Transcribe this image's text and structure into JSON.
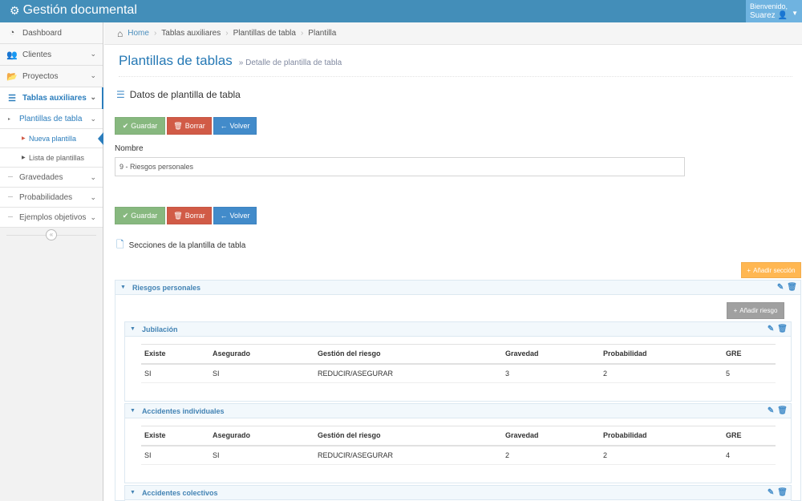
{
  "navbar": {
    "brand": "Gestión documental",
    "welcome": "Bienvenido,",
    "user": "Suarez"
  },
  "sidebar": {
    "items": [
      {
        "label": "Dashboard",
        "icon": "tachometer-icon"
      },
      {
        "label": "Clientes",
        "icon": "users-icon"
      },
      {
        "label": "Proyectos",
        "icon": "folder-open-icon"
      },
      {
        "label": "Tablas auxiliares",
        "icon": "list-icon"
      }
    ],
    "sub": {
      "plantillas": "Plantillas de tabla",
      "nueva": "Nueva plantilla",
      "lista": "Lista de plantillas",
      "gravedades": "Gravedades",
      "probabilidades": "Probabilidades",
      "ejemplos": "Ejemplos objetivos"
    }
  },
  "breadcrumb": [
    "Home",
    "Tablas auxiliares",
    "Plantillas de tabla",
    "Plantilla"
  ],
  "page": {
    "title": "Plantillas de tablas",
    "subtitle": "Detalle de plantilla de tabla",
    "datos_title": "Datos de plantilla de tabla",
    "nombre_label": "Nombre",
    "nombre_value": "9 - Riesgos personales",
    "secciones_title": "Secciones de la plantilla de tabla"
  },
  "buttons": {
    "guardar": "Guardar",
    "borrar": "Borrar",
    "volver": "Volver",
    "anadir_seccion": "Añadir sección",
    "anadir_riesgo": "Añadir riesgo"
  },
  "section": {
    "title": "Riesgos personales",
    "columns": [
      "Existe",
      "Asegurado",
      "Gestión del riesgo",
      "Gravedad",
      "Probabilidad",
      "GRE"
    ],
    "subsections": [
      {
        "title": "Jubilación",
        "row": [
          "SI",
          "SI",
          "REDUCIR/ASEGURAR",
          "3",
          "2",
          "5"
        ]
      },
      {
        "title": "Accidentes individuales",
        "row": [
          "SI",
          "SI",
          "REDUCIR/ASEGURAR",
          "2",
          "2",
          "4"
        ]
      },
      {
        "title": "Accidentes colectivos"
      }
    ]
  },
  "colors": {
    "navbar": "#438eb9",
    "accent": "#2679b5",
    "success": "#87b87f",
    "danger": "#d15b47",
    "primary": "#428bca",
    "warning": "#ffb752"
  }
}
